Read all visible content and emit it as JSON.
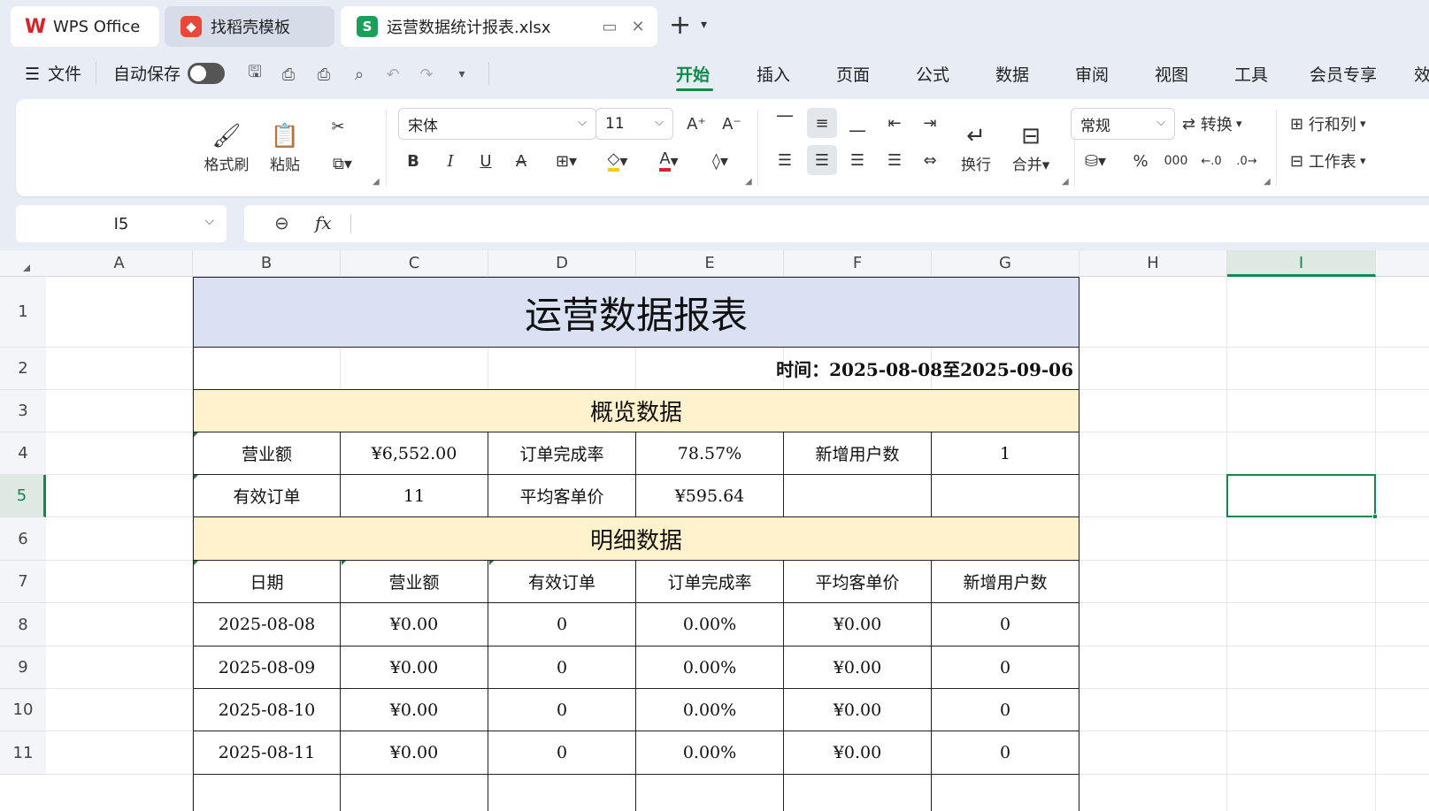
{
  "tabs": {
    "wps": "WPS Office",
    "template": "找稻壳模板",
    "file": "运营数据统计报表.xlsx",
    "file_icon": "S"
  },
  "menu": {
    "file": "文件",
    "autosave": "自动保存",
    "ribbon_tabs": [
      "开始",
      "插入",
      "页面",
      "公式",
      "数据",
      "审阅",
      "视图",
      "工具",
      "会员专享",
      "效"
    ]
  },
  "ribbon": {
    "format_painter": "格式刷",
    "paste": "粘贴",
    "font_name": "宋体",
    "font_size": "11",
    "wrap": "换行",
    "merge": "合并",
    "number_format": "常规",
    "convert": "转换",
    "row_col": "行和列",
    "worksheet": "工作表"
  },
  "formula_bar": {
    "cell_ref": "I5",
    "fx": "fx",
    "content": ""
  },
  "sheet": {
    "columns": [
      "A",
      "B",
      "C",
      "D",
      "E",
      "F",
      "G",
      "H",
      "I"
    ],
    "active_column": "I",
    "rows": [
      "1",
      "2",
      "3",
      "4",
      "5",
      "6",
      "7",
      "8",
      "9",
      "10",
      "11"
    ],
    "active_row": "5",
    "title": "运营数据报表",
    "date_range": "时间：2025-08-08至2025-09-06",
    "overview_title": "概览数据",
    "overview": [
      [
        "营业额",
        "¥6,552.00",
        "订单完成率",
        "78.57%",
        "新增用户数",
        "1"
      ],
      [
        "有效订单",
        "11",
        "平均客单价",
        "¥595.64",
        "",
        ""
      ]
    ],
    "detail_title": "明细数据",
    "detail_headers": [
      "日期",
      "营业额",
      "有效订单",
      "订单完成率",
      "平均客单价",
      "新增用户数"
    ],
    "detail_rows": [
      [
        "2025-08-08",
        "¥0.00",
        "0",
        "0.00%",
        "¥0.00",
        "0"
      ],
      [
        "2025-08-09",
        "¥0.00",
        "0",
        "0.00%",
        "¥0.00",
        "0"
      ],
      [
        "2025-08-10",
        "¥0.00",
        "0",
        "0.00%",
        "¥0.00",
        "0"
      ],
      [
        "2025-08-11",
        "¥0.00",
        "0",
        "0.00%",
        "¥0.00",
        "0"
      ]
    ]
  },
  "colors": {
    "accent": "#0f8a4a",
    "title_fill": "#d9e1f2",
    "section_fill": "#fff2cc"
  }
}
